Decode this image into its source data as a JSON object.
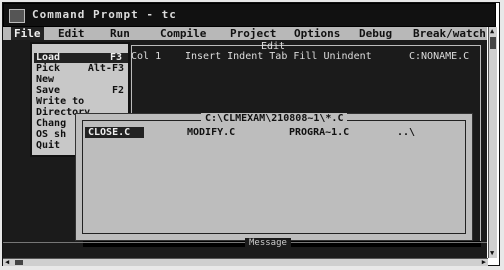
{
  "window": {
    "title": "Command Prompt - tc",
    "icon": "terminal-icon"
  },
  "menubar": {
    "items": [
      {
        "label": "File"
      },
      {
        "label": "Edit"
      },
      {
        "label": "Run"
      },
      {
        "label": "Compile"
      },
      {
        "label": "Project"
      },
      {
        "label": "Options"
      },
      {
        "label": "Debug"
      },
      {
        "label": "Break/watch"
      }
    ],
    "active": "File"
  },
  "editor": {
    "title": "Edit",
    "status": {
      "column": "Col 1",
      "mode": "Insert Indent Tab Fill Unindent",
      "filename": "C:NONAME.C"
    }
  },
  "file_menu": {
    "items": [
      {
        "label": "Load",
        "shortcut": "F3",
        "selected": true
      },
      {
        "label": "Pick",
        "shortcut": "Alt-F3"
      },
      {
        "label": "New",
        "shortcut": ""
      },
      {
        "label": "Save",
        "shortcut": "F2"
      },
      {
        "label": "Write to",
        "shortcut": ""
      },
      {
        "label": "Directory",
        "shortcut": ""
      },
      {
        "label": "Chang",
        "shortcut": ""
      },
      {
        "label": "OS sh",
        "shortcut": ""
      },
      {
        "label": "Quit",
        "shortcut": ""
      }
    ]
  },
  "load_dialog": {
    "title": "C:\\CLMEXAM\\210808~1\\*.C",
    "files": [
      {
        "name": "CLOSE.C",
        "selected": true
      },
      {
        "name": "MODIFY.C"
      },
      {
        "name": "PROGRA~1.C"
      },
      {
        "name": "..\\"
      }
    ]
  },
  "message": {
    "title": "Message"
  },
  "colors": {
    "screen_bg": "#1b1b1b",
    "menu_bg": "#b8b8b8",
    "dialog_bg": "#bdbdbd",
    "highlight": "#222222"
  }
}
